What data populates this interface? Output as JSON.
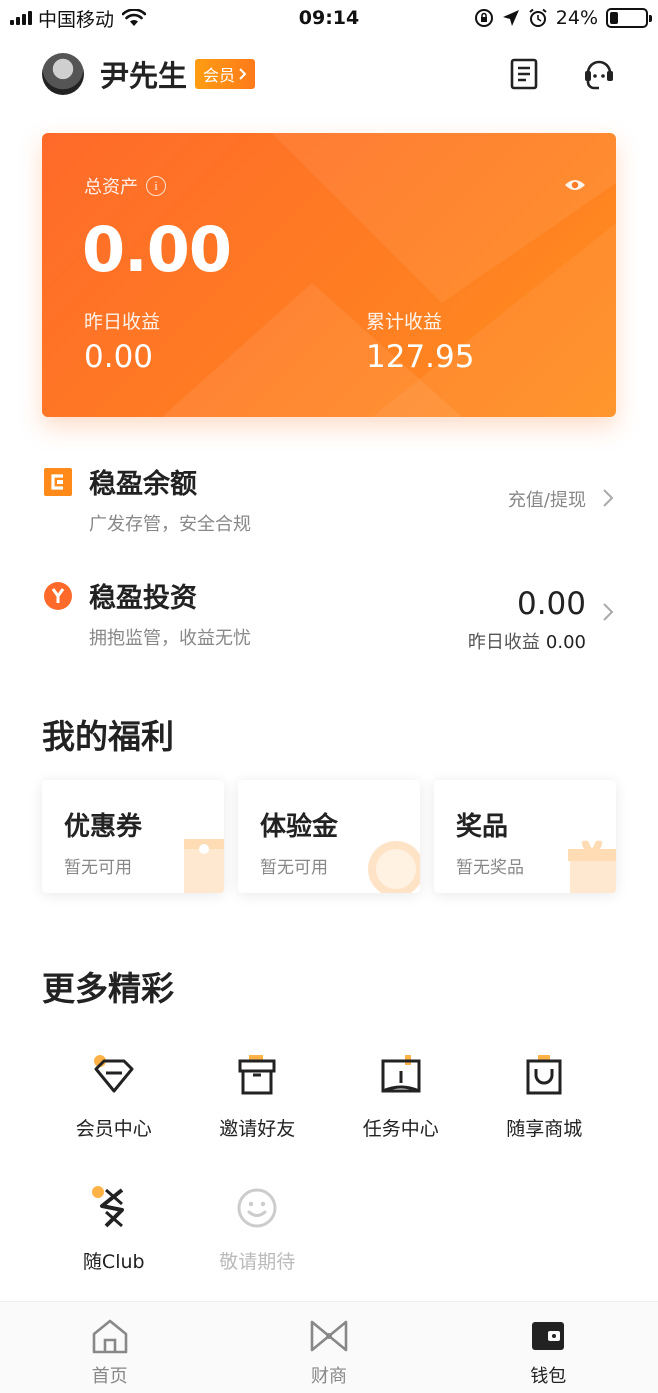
{
  "status_bar": {
    "carrier": "中国移动",
    "time": "09:14",
    "battery_text": "24%",
    "battery_level": 0.24
  },
  "header": {
    "user_name": "尹先生",
    "member_badge": "会员",
    "icons": [
      "document-icon",
      "customer-service-icon"
    ]
  },
  "asset_card": {
    "total_label": "总资产",
    "total_value": "0.00",
    "yesterday_label": "昨日收益",
    "yesterday_value": "0.00",
    "cumulative_label": "累计收益",
    "cumulative_value": "127.95",
    "colors": {
      "start": "#ff6a2a",
      "end": "#ff9020"
    }
  },
  "products": [
    {
      "title": "稳盈余额",
      "subtitle": "广发存管，安全合规",
      "action": "充值/提现",
      "icon": "balance-icon"
    },
    {
      "title": "稳盈投资",
      "subtitle": "拥抱监管，收益无忧",
      "amount": "0.00",
      "yesterday_label": "昨日收益",
      "yesterday_value": "0.00",
      "icon": "invest-icon"
    }
  ],
  "welfare": {
    "title": "我的福利",
    "cards": [
      {
        "title": "优惠券",
        "subtitle": "暂无可用"
      },
      {
        "title": "体验金",
        "subtitle": "暂无可用"
      },
      {
        "title": "奖品",
        "subtitle": "暂无奖品"
      }
    ]
  },
  "more": {
    "title": "更多精彩",
    "items": [
      {
        "label": "会员中心",
        "icon": "diamond-icon"
      },
      {
        "label": "邀请好友",
        "icon": "gift-box-icon"
      },
      {
        "label": "任务中心",
        "icon": "book-icon"
      },
      {
        "label": "随享商城",
        "icon": "shopping-bag-icon"
      },
      {
        "label": "随Club",
        "icon": "club-logo-icon"
      },
      {
        "label": "敬请期待",
        "icon": "smile-icon"
      }
    ]
  },
  "bottom_nav": {
    "items": [
      {
        "label": "首页",
        "icon": "home-icon"
      },
      {
        "label": "财商",
        "icon": "bow-icon"
      },
      {
        "label": "钱包",
        "icon": "wallet-icon"
      }
    ],
    "active": "钱包"
  },
  "colors": {
    "accent": "#ff7a1a",
    "badge": "#ff9d12",
    "text_primary": "#222222",
    "text_secondary": "#888888"
  }
}
